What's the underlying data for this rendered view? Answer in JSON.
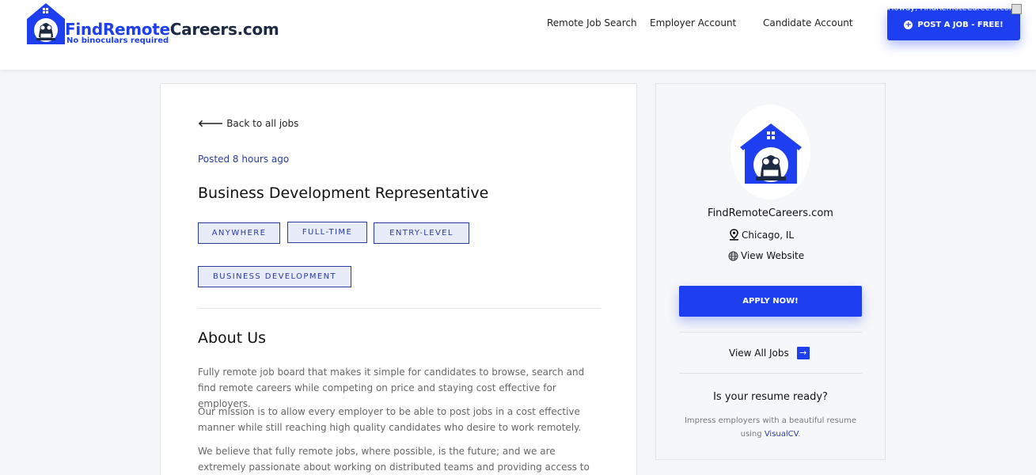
{
  "header": {
    "logo_find": "Find",
    "logo_remote": "Remote",
    "logo_careers": "Careers.com",
    "tagline": "No binoculars required",
    "nav": [
      "Remote Job Search",
      "Employer Account",
      "Candidate Account"
    ],
    "howdy": "Howdy, FindRemoteCareers.com",
    "post_job_label": "POST A JOB - FREE!"
  },
  "job": {
    "back_label": "Back to all jobs",
    "posted": "Posted 8 hours ago",
    "title": "Business Development Representative",
    "tags": [
      "ANYWHERE",
      "FULL-TIME",
      "ENTRY-LEVEL",
      "BUSINESS DEVELOPMENT"
    ],
    "about_title": "About Us",
    "paragraphs": [
      "Fully remote job board that makes it simple for candidates to browse, search and find remote careers while competing on price and staying cost effective for employers.",
      "Our mission is to allow every employer to be able to post jobs in a cost effective manner while still reaching high quality candidates who desire to work remotely.",
      "We believe that fully remote jobs, where possible, is the future; and we are extremely passionate about working on distributed teams and providing access to work to anyone"
    ]
  },
  "sidebar": {
    "company": "FindRemoteCareers.com",
    "location": "Chicago, IL",
    "website_label": "View Website",
    "apply_label": "APPLY NOW!",
    "view_all_label": "View All Jobs",
    "resume_title": "Is your resume ready?",
    "resume_text": "Impress employers with a beautiful resume using",
    "resume_link": "VisualCV",
    "resume_end": "."
  },
  "colors": {
    "brand_blue": "#1e3ff0",
    "tag_text": "#2a3b9e",
    "navy": "#1d2a44"
  }
}
